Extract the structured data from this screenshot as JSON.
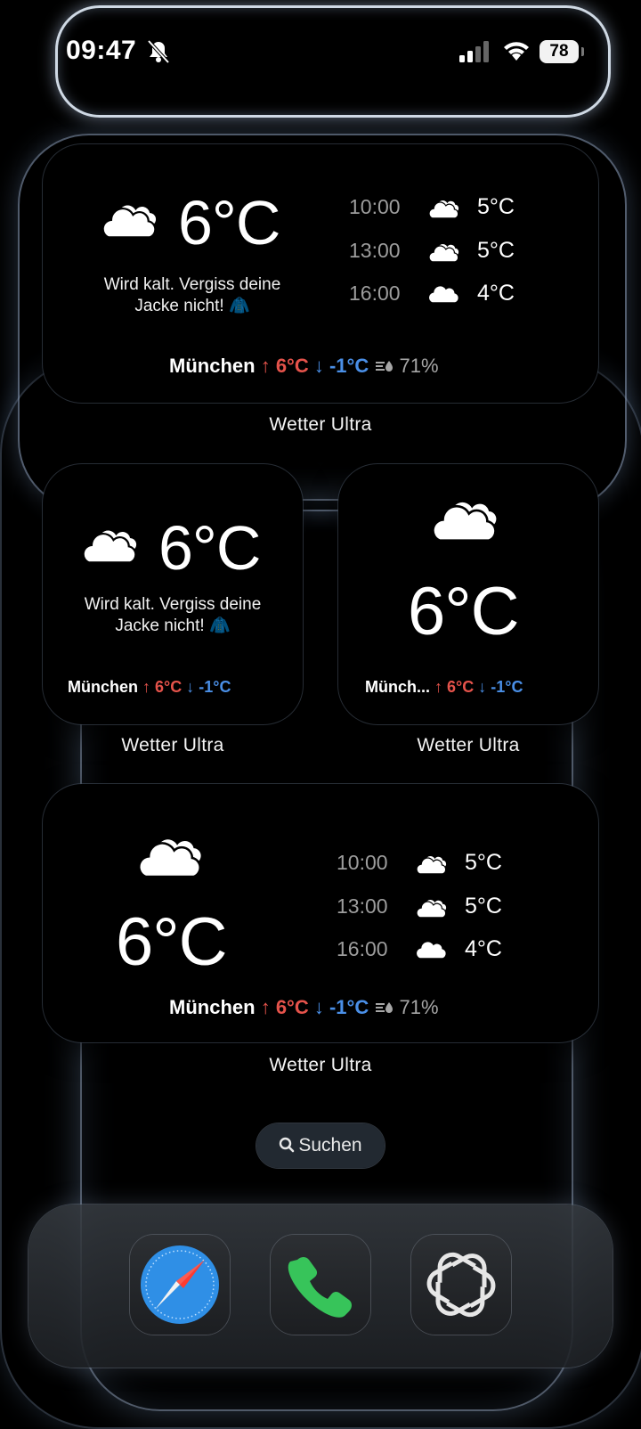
{
  "status_bar": {
    "time": "09:47",
    "battery": "78"
  },
  "colors": {
    "high": "#e5534b",
    "low": "#4a8fe7",
    "secondary": "#9d9d9d"
  },
  "widgets": {
    "large_top": {
      "temp": "6°C",
      "message_line1": "Wird kalt. Vergiss deine",
      "message_line2": "Jacke nicht! 🧥",
      "forecast": [
        {
          "time": "10:00",
          "icon": "mostly-cloudy-icon",
          "temp": "5°C"
        },
        {
          "time": "13:00",
          "icon": "mostly-cloudy-icon",
          "temp": "5°C"
        },
        {
          "time": "16:00",
          "icon": "cloud-icon",
          "temp": "4°C"
        }
      ],
      "city": "München",
      "high_arrow": "↑",
      "high": "6°C",
      "low_arrow": "↓",
      "low": "-1°C",
      "humidity_icon": "humidity-icon",
      "humidity": "71%",
      "label": "Wetter Ultra"
    },
    "small_left": {
      "temp": "6°C",
      "message_line1": "Wird kalt. Vergiss deine",
      "message_line2": "Jacke nicht! 🧥",
      "city": "München",
      "high_arrow": "↑",
      "high": "6°C",
      "low_arrow": "↓",
      "low": "-1°C",
      "label": "Wetter Ultra"
    },
    "small_right": {
      "temp": "6°C",
      "city": "Münch...",
      "high_arrow": "↑",
      "high": "6°C",
      "low_arrow": "↓",
      "low": "-1°C",
      "label": "Wetter Ultra"
    },
    "large_bottom": {
      "temp": "6°C",
      "forecast": [
        {
          "time": "10:00",
          "icon": "mostly-cloudy-icon",
          "temp": "5°C"
        },
        {
          "time": "13:00",
          "icon": "mostly-cloudy-icon",
          "temp": "5°C"
        },
        {
          "time": "16:00",
          "icon": "cloud-icon",
          "temp": "4°C"
        }
      ],
      "city": "München",
      "high_arrow": "↑",
      "high": "6°C",
      "low_arrow": "↓",
      "low": "-1°C",
      "humidity_icon": "humidity-icon",
      "humidity": "71%",
      "label": "Wetter Ultra"
    }
  },
  "search": {
    "label": "Suchen",
    "icon": "search-icon"
  },
  "dock": {
    "apps": [
      {
        "icon": "safari-icon"
      },
      {
        "icon": "phone-icon"
      },
      {
        "icon": "chatgpt-icon"
      }
    ]
  }
}
